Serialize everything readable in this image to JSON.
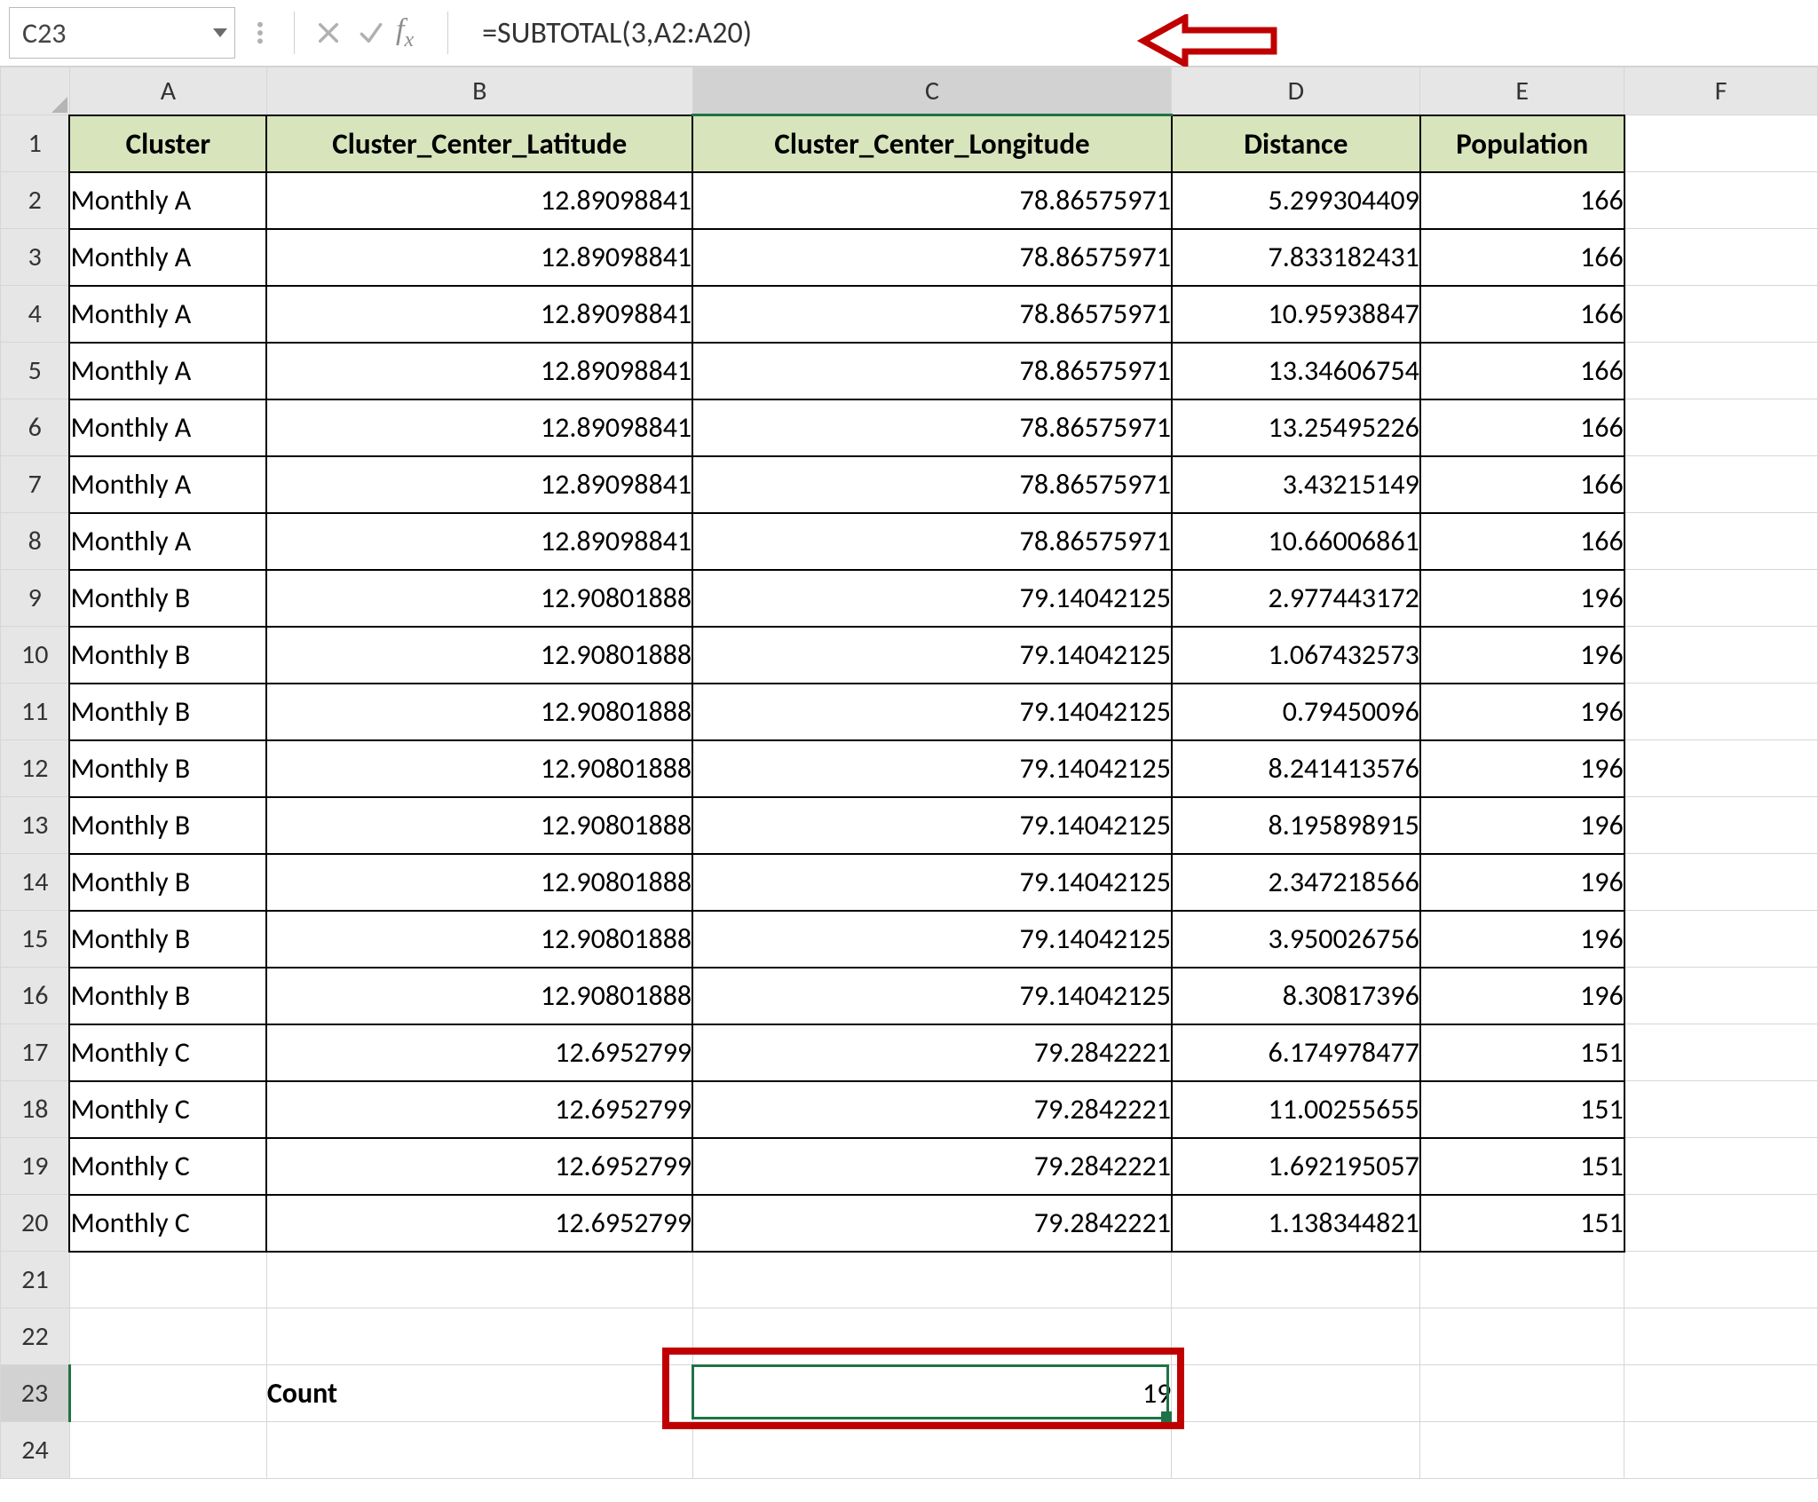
{
  "name_box": "C23",
  "formula": "=SUBTOTAL(3,A2:A20)",
  "columns": [
    "A",
    "B",
    "C",
    "D",
    "E",
    "F"
  ],
  "row_numbers": [
    1,
    2,
    3,
    4,
    5,
    6,
    7,
    8,
    9,
    10,
    11,
    12,
    13,
    14,
    15,
    16,
    17,
    18,
    19,
    20,
    21,
    22,
    23,
    24
  ],
  "headers": {
    "A": "Cluster",
    "B": "Cluster_Center_Latitude",
    "C": "Cluster_Center_Longitude",
    "D": "Distance",
    "E": "Population"
  },
  "rows": [
    {
      "A": "Monthly A",
      "B": "12.89098841",
      "C": "78.86575971",
      "D": "5.299304409",
      "E": "166"
    },
    {
      "A": "Monthly A",
      "B": "12.89098841",
      "C": "78.86575971",
      "D": "7.833182431",
      "E": "166"
    },
    {
      "A": "Monthly A",
      "B": "12.89098841",
      "C": "78.86575971",
      "D": "10.95938847",
      "E": "166"
    },
    {
      "A": "Monthly A",
      "B": "12.89098841",
      "C": "78.86575971",
      "D": "13.34606754",
      "E": "166"
    },
    {
      "A": "Monthly A",
      "B": "12.89098841",
      "C": "78.86575971",
      "D": "13.25495226",
      "E": "166"
    },
    {
      "A": "Monthly A",
      "B": "12.89098841",
      "C": "78.86575971",
      "D": "3.43215149",
      "E": "166"
    },
    {
      "A": "Monthly A",
      "B": "12.89098841",
      "C": "78.86575971",
      "D": "10.66006861",
      "E": "166"
    },
    {
      "A": "Monthly B",
      "B": "12.90801888",
      "C": "79.14042125",
      "D": "2.977443172",
      "E": "196"
    },
    {
      "A": "Monthly B",
      "B": "12.90801888",
      "C": "79.14042125",
      "D": "1.067432573",
      "E": "196"
    },
    {
      "A": "Monthly B",
      "B": "12.90801888",
      "C": "79.14042125",
      "D": "0.79450096",
      "E": "196"
    },
    {
      "A": "Monthly B",
      "B": "12.90801888",
      "C": "79.14042125",
      "D": "8.241413576",
      "E": "196"
    },
    {
      "A": "Monthly B",
      "B": "12.90801888",
      "C": "79.14042125",
      "D": "8.195898915",
      "E": "196"
    },
    {
      "A": "Monthly B",
      "B": "12.90801888",
      "C": "79.14042125",
      "D": "2.347218566",
      "E": "196"
    },
    {
      "A": "Monthly B",
      "B": "12.90801888",
      "C": "79.14042125",
      "D": "3.950026756",
      "E": "196"
    },
    {
      "A": "Monthly B",
      "B": "12.90801888",
      "C": "79.14042125",
      "D": "8.30817396",
      "E": "196"
    },
    {
      "A": "Monthly C",
      "B": "12.6952799",
      "C": "79.2842221",
      "D": "6.174978477",
      "E": "151"
    },
    {
      "A": "Monthly C",
      "B": "12.6952799",
      "C": "79.2842221",
      "D": "11.00255655",
      "E": "151"
    },
    {
      "A": "Monthly C",
      "B": "12.6952799",
      "C": "79.2842221",
      "D": "1.692195057",
      "E": "151"
    },
    {
      "A": "Monthly C",
      "B": "12.6952799",
      "C": "79.2842221",
      "D": "1.138344821",
      "E": "151"
    }
  ],
  "count_label": "Count",
  "count_value": "19",
  "selected_cell": "C23"
}
